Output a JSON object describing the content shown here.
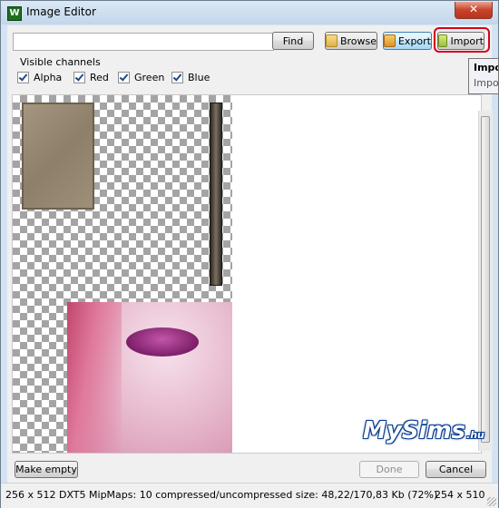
{
  "window": {
    "title": "Image Editor",
    "icon_letter": "W",
    "close_glyph": "✕"
  },
  "toolbar": {
    "search_value": "",
    "find_label": "Find",
    "browse_label": "Browse",
    "export_label": "Export",
    "import_label": "Import"
  },
  "channels": {
    "label": "Visible channels",
    "items": [
      {
        "label": "Alpha",
        "checked": true
      },
      {
        "label": "Red",
        "checked": true
      },
      {
        "label": "Green",
        "checked": true
      },
      {
        "label": "Blue",
        "checked": true
      }
    ]
  },
  "tooltip": {
    "title": "Import",
    "text": "Import"
  },
  "bottom": {
    "make_empty_label": "Make empty",
    "done_label": "Done",
    "cancel_label": "Cancel"
  },
  "watermark": {
    "brand": "MySims",
    "suffix": ".hu"
  },
  "status": {
    "info": "256 x 512 DXT5 MipMaps: 10 compressed/uncompressed size: 48,22/170,83 Kb (72%)",
    "dims": "254 x 510"
  },
  "colors": {
    "accent": "#3c7fb1",
    "close": "#c7432a",
    "highlight": "#d7001b"
  },
  "icons": {
    "browse": "folder-icon",
    "export": "export-box-icon",
    "import": "import-box-icon",
    "checkbox": "checkmark-icon"
  }
}
